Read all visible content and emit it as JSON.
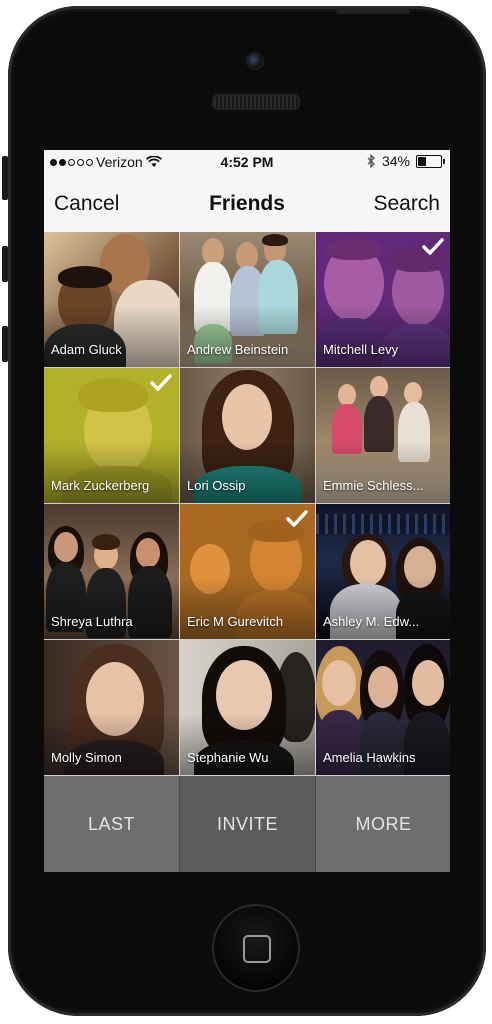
{
  "status_bar": {
    "carrier": "Verizon",
    "time": "4:52 PM",
    "battery": "34%",
    "battery_level": 0.34
  },
  "nav": {
    "cancel_label": "Cancel",
    "title": "Friends",
    "search_label": "Search"
  },
  "friends": [
    {
      "name": "Adam Gluck",
      "selected": false
    },
    {
      "name": "Andrew Beinstein",
      "selected": false
    },
    {
      "name": "Mitchell Levy",
      "selected": true,
      "tint": "#8a2fb0"
    },
    {
      "name": "Mark Zuckerberg",
      "selected": true,
      "tint": "#d6d21e"
    },
    {
      "name": "Lori Ossip",
      "selected": false
    },
    {
      "name": "Emmie Schless...",
      "selected": false
    },
    {
      "name": "Shreya Luthra",
      "selected": false
    },
    {
      "name": "Eric M Gurevitch",
      "selected": true,
      "tint": "#e58a1e"
    },
    {
      "name": "Ashley M. Edw...",
      "selected": false
    },
    {
      "name": "Molly Simon",
      "selected": false
    },
    {
      "name": "Stephanie Wu",
      "selected": false
    },
    {
      "name": "Amelia Hawkins",
      "selected": false
    }
  ],
  "actions": {
    "last_label": "LAST",
    "invite_label": "INVITE",
    "more_label": "MORE"
  }
}
